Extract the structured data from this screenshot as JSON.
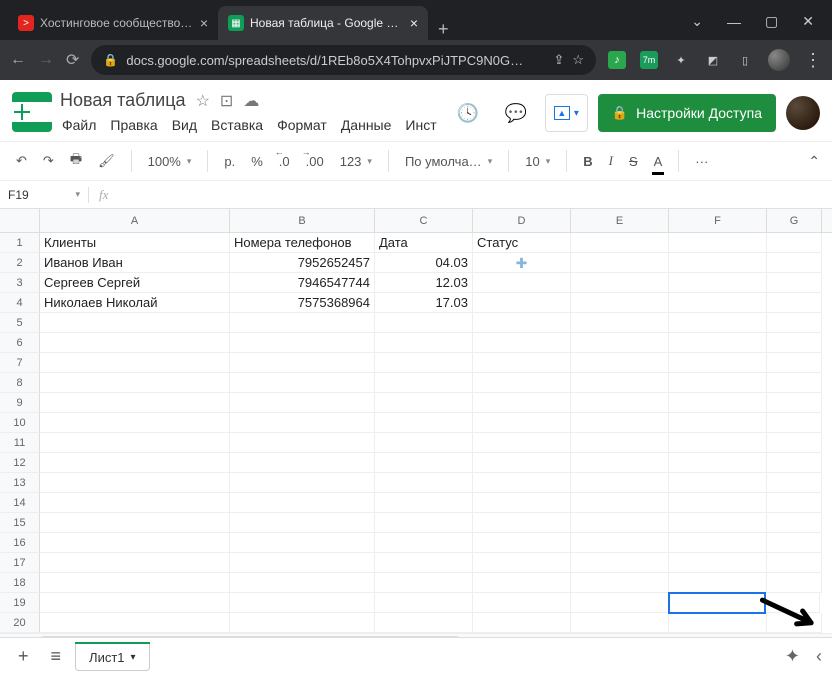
{
  "browser": {
    "tabs": [
      {
        "label": "Хостинговое сообщество «Tim…",
        "favicon_bg": "#e2261f",
        "favicon_text": ">"
      },
      {
        "label": "Новая таблица - Google Табли…",
        "favicon_bg": "#0f9d58",
        "favicon_text": "▦"
      }
    ],
    "url": "docs.google.com/spreadsheets/d/1REb8o5X4TohpvxPiJTPC9N0G…"
  },
  "doc": {
    "title": "Новая таблица",
    "menus": [
      "Файл",
      "Правка",
      "Вид",
      "Вставка",
      "Формат",
      "Данные",
      "Инст"
    ],
    "share_label": "Настройки Доступа"
  },
  "toolbar": {
    "zoom": "100%",
    "currency": "р.",
    "percent": "%",
    "dec_dec": ".0",
    "inc_dec": ".00",
    "format123": "123",
    "font": "По умолча…",
    "font_size": "10",
    "bold": "B",
    "italic": "I",
    "strike": "S",
    "color": "A",
    "more": "···"
  },
  "fx": {
    "name_box": "F19"
  },
  "sheet": {
    "columns": [
      "A",
      "B",
      "C",
      "D",
      "E",
      "F",
      "G"
    ],
    "col_widths": [
      "col-A",
      "col-B",
      "col-C",
      "col-D",
      "col-E",
      "col-F",
      "col-G"
    ],
    "row_count": 20,
    "headers": {
      "A": "Клиенты",
      "B": "Номера телефонов",
      "C": "Дата",
      "D": "Статус"
    },
    "rows": [
      {
        "A": "Иванов Иван",
        "B": "7952652457",
        "C": "04.03"
      },
      {
        "A": "Сергеев Сергей",
        "B": "7946547744",
        "C": "12.03"
      },
      {
        "A": "Николаев Николай",
        "B": "7575368964",
        "C": "17.03"
      }
    ],
    "cursor_marker_cell": "D2",
    "selected_cell": "F19"
  },
  "sheet_tab": {
    "name": "Лист1"
  }
}
